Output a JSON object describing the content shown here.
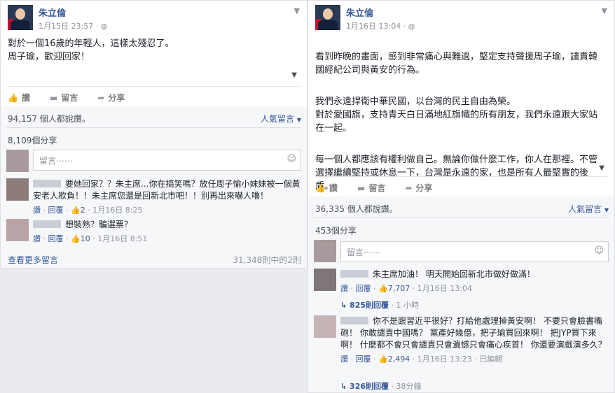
{
  "post1": {
    "author": "朱立倫",
    "timestamp": "1月15日 23:57 · ",
    "globe_icon": "globe-icon",
    "paragraphs": [
      "對於一個16歲的年輕人，這樣太殘忍了。",
      "周子瑜，歡迎回家！"
    ],
    "actions": {
      "like": "讚",
      "comment": "留言",
      "share": "分享"
    },
    "likes_text": "94,157 個人都說讚。",
    "sort_label": "人氣留言",
    "shares_text": "8,109個分享",
    "comment_placeholder": "留言⋯⋯",
    "comments": [
      {
        "text": "要她回家？？朱主席...你在搞笑嗎？放任周子愉小妹妹被一個黃安老人欺負！！朱主席您還是回新北市吧！！別再出來嚇人嚕！",
        "like": "讚",
        "reply": "回覆",
        "count": "2",
        "time": "1月16日 8:25"
      },
      {
        "text": "想裝熟？騙選票？",
        "like": "讚",
        "reply": "回覆",
        "count": "10",
        "time": "1月16日 8:51"
      }
    ],
    "more_comments": "查看更多留言",
    "pagination": "31,348則中的2則"
  },
  "post2": {
    "author": "朱立倫",
    "timestamp": "1月16日 13:04 · ",
    "globe_icon": "globe-icon",
    "paragraphs": [
      "看到昨晚的畫面，感到非常痛心與難過，堅定支持聲援周子瑜，譴責韓國經紀公司與黃安的行為。",
      "我們永遠捍衛中華民國，以台灣的民主自由為榮。\n對於愛國旗，支持青天白日滿地紅旗幟的所有朋友，我們永遠跟大家站在一起。",
      "每一個人都應該有權利做自己。無論你做什麼工作，你人在那裡。不管選擇繼續堅持或休息一下，台灣是永遠的家，也是所有人最堅實的後盾。"
    ],
    "actions": {
      "like": "讚",
      "comment": "留言",
      "share": "分享"
    },
    "likes_text": "36,335 個人都說讚。",
    "sort_label": "人氣留言",
    "shares_text": "453個分享",
    "comment_placeholder": "留言⋯⋯",
    "comments": [
      {
        "text": "朱主席加油！ 明天開始回新北市做好做滿！",
        "like": "讚",
        "reply": "回覆",
        "count": "7,707",
        "time": "1月16日 13:04",
        "replies": "825則回覆",
        "replies_time": "1 小時"
      },
      {
        "text": "你不是跟習近平很好？打給他處理掉黃安啊！ 不要只會臉書嘴砲！ 你敢譴責中國嗎？ 黨產好幾億，把子瑜買回來啊！ 把JYP買下來啊！ 什麼都不會只會譴責只會遺憾只會痛心疾首！ 你還要演戲演多久？",
        "like": "讚",
        "reply": "回覆",
        "count": "2,494",
        "time": "1月16日 13:23",
        "edited": "已編輯",
        "replies": "326則回覆",
        "replies_time": "38分鐘"
      }
    ]
  }
}
